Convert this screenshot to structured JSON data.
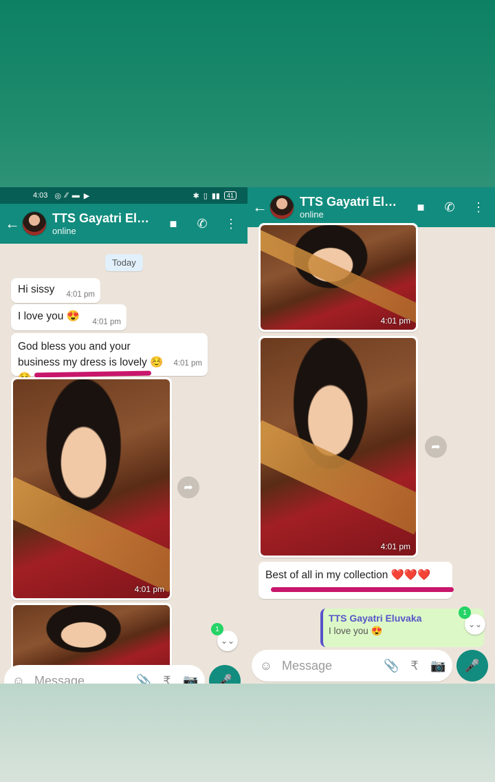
{
  "left": {
    "status_bar": {
      "time": "4:03",
      "icons": [
        "instagram-icon",
        "n-icon",
        "message-icon",
        "play-icon"
      ],
      "right": [
        "bluetooth-icon",
        "vibrate-icon",
        "signal-icon"
      ],
      "battery": "41"
    },
    "header": {
      "back": "←",
      "name": "TTS Gayatri Eluv...",
      "status": "online",
      "video": "■",
      "call": "✆",
      "more": "⋮"
    },
    "date_chip": "Today",
    "messages": [
      {
        "text": "Hi sissy",
        "time": "4:01 pm"
      },
      {
        "text": "I love you 😍",
        "time": "4:01 pm"
      },
      {
        "text": "God bless you and your business my dress is lovely ☺️☺️",
        "time": "4:01 pm"
      }
    ],
    "photo_time": "4:01 pm",
    "forward": "➦",
    "scroll_badge": "1",
    "scroll_down": "⌄⌄",
    "input": {
      "placeholder": "Message",
      "emoji": "☺",
      "attach": "📎",
      "rupee": "₹",
      "camera": "📷",
      "mic": "🎤"
    }
  },
  "right": {
    "header": {
      "back": "←",
      "name": "TTS Gayatri Eluv...",
      "status": "online",
      "video": "■",
      "call": "✆",
      "more": "⋮"
    },
    "photo_time_1": "4:01 pm",
    "photo_time_2": "4:01 pm",
    "forward": "➦",
    "message": {
      "text": "Best of all in my collection ❤️❤️❤️"
    },
    "reply_preview": {
      "name": "TTS Gayatri Eluvaka",
      "text": "I love you 😍"
    },
    "scroll_badge": "1",
    "scroll_down": "⌄⌄",
    "input": {
      "placeholder": "Message",
      "emoji": "☺",
      "attach": "📎",
      "rupee": "₹",
      "camera": "📷",
      "mic": "🎤"
    }
  },
  "colors": {
    "header": "#128c7e",
    "status_bar": "#075e54",
    "chat_bg": "#ece4da",
    "highlight": "#c8166b",
    "outgoing": "#dcf8c6"
  }
}
